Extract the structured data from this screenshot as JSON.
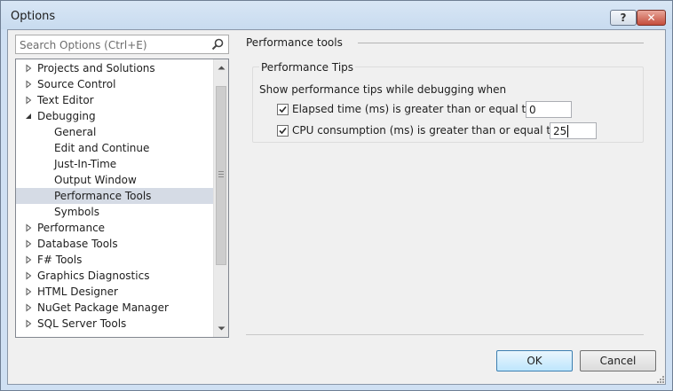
{
  "window": {
    "title": "Options",
    "help_glyph": "?",
    "close_glyph": "✕"
  },
  "search": {
    "placeholder": "Search Options (Ctrl+E)"
  },
  "tree": {
    "items": [
      {
        "label": "Projects and Solutions",
        "expanded": false
      },
      {
        "label": "Source Control",
        "expanded": false
      },
      {
        "label": "Text Editor",
        "expanded": false
      },
      {
        "label": "Debugging",
        "expanded": true
      },
      {
        "label": "General",
        "child": true
      },
      {
        "label": "Edit and Continue",
        "child": true
      },
      {
        "label": "Just-In-Time",
        "child": true
      },
      {
        "label": "Output Window",
        "child": true
      },
      {
        "label": "Performance Tools",
        "child": true,
        "selected": true
      },
      {
        "label": "Symbols",
        "child": true
      },
      {
        "label": "Performance",
        "expanded": false
      },
      {
        "label": "Database Tools",
        "expanded": false
      },
      {
        "label": "F# Tools",
        "expanded": false
      },
      {
        "label": "Graphics Diagnostics",
        "expanded": false
      },
      {
        "label": "HTML Designer",
        "expanded": false
      },
      {
        "label": "NuGet Package Manager",
        "expanded": false
      },
      {
        "label": "SQL Server Tools",
        "expanded": false
      }
    ]
  },
  "panel": {
    "page_title": "Performance tools",
    "group_label": "Performance Tips",
    "description": "Show performance tips while debugging when",
    "options": [
      {
        "label": "Elapsed time (ms) is greater than or equal to",
        "checked": true,
        "value": "0"
      },
      {
        "label": "CPU consumption (ms) is greater than or equal to",
        "checked": true,
        "value": "25"
      }
    ]
  },
  "buttons": {
    "ok": "OK",
    "cancel": "Cancel"
  },
  "colors": {
    "selection": "#d5dbe5",
    "ok_border": "#3c7fb1",
    "close": "#c44d3c"
  }
}
